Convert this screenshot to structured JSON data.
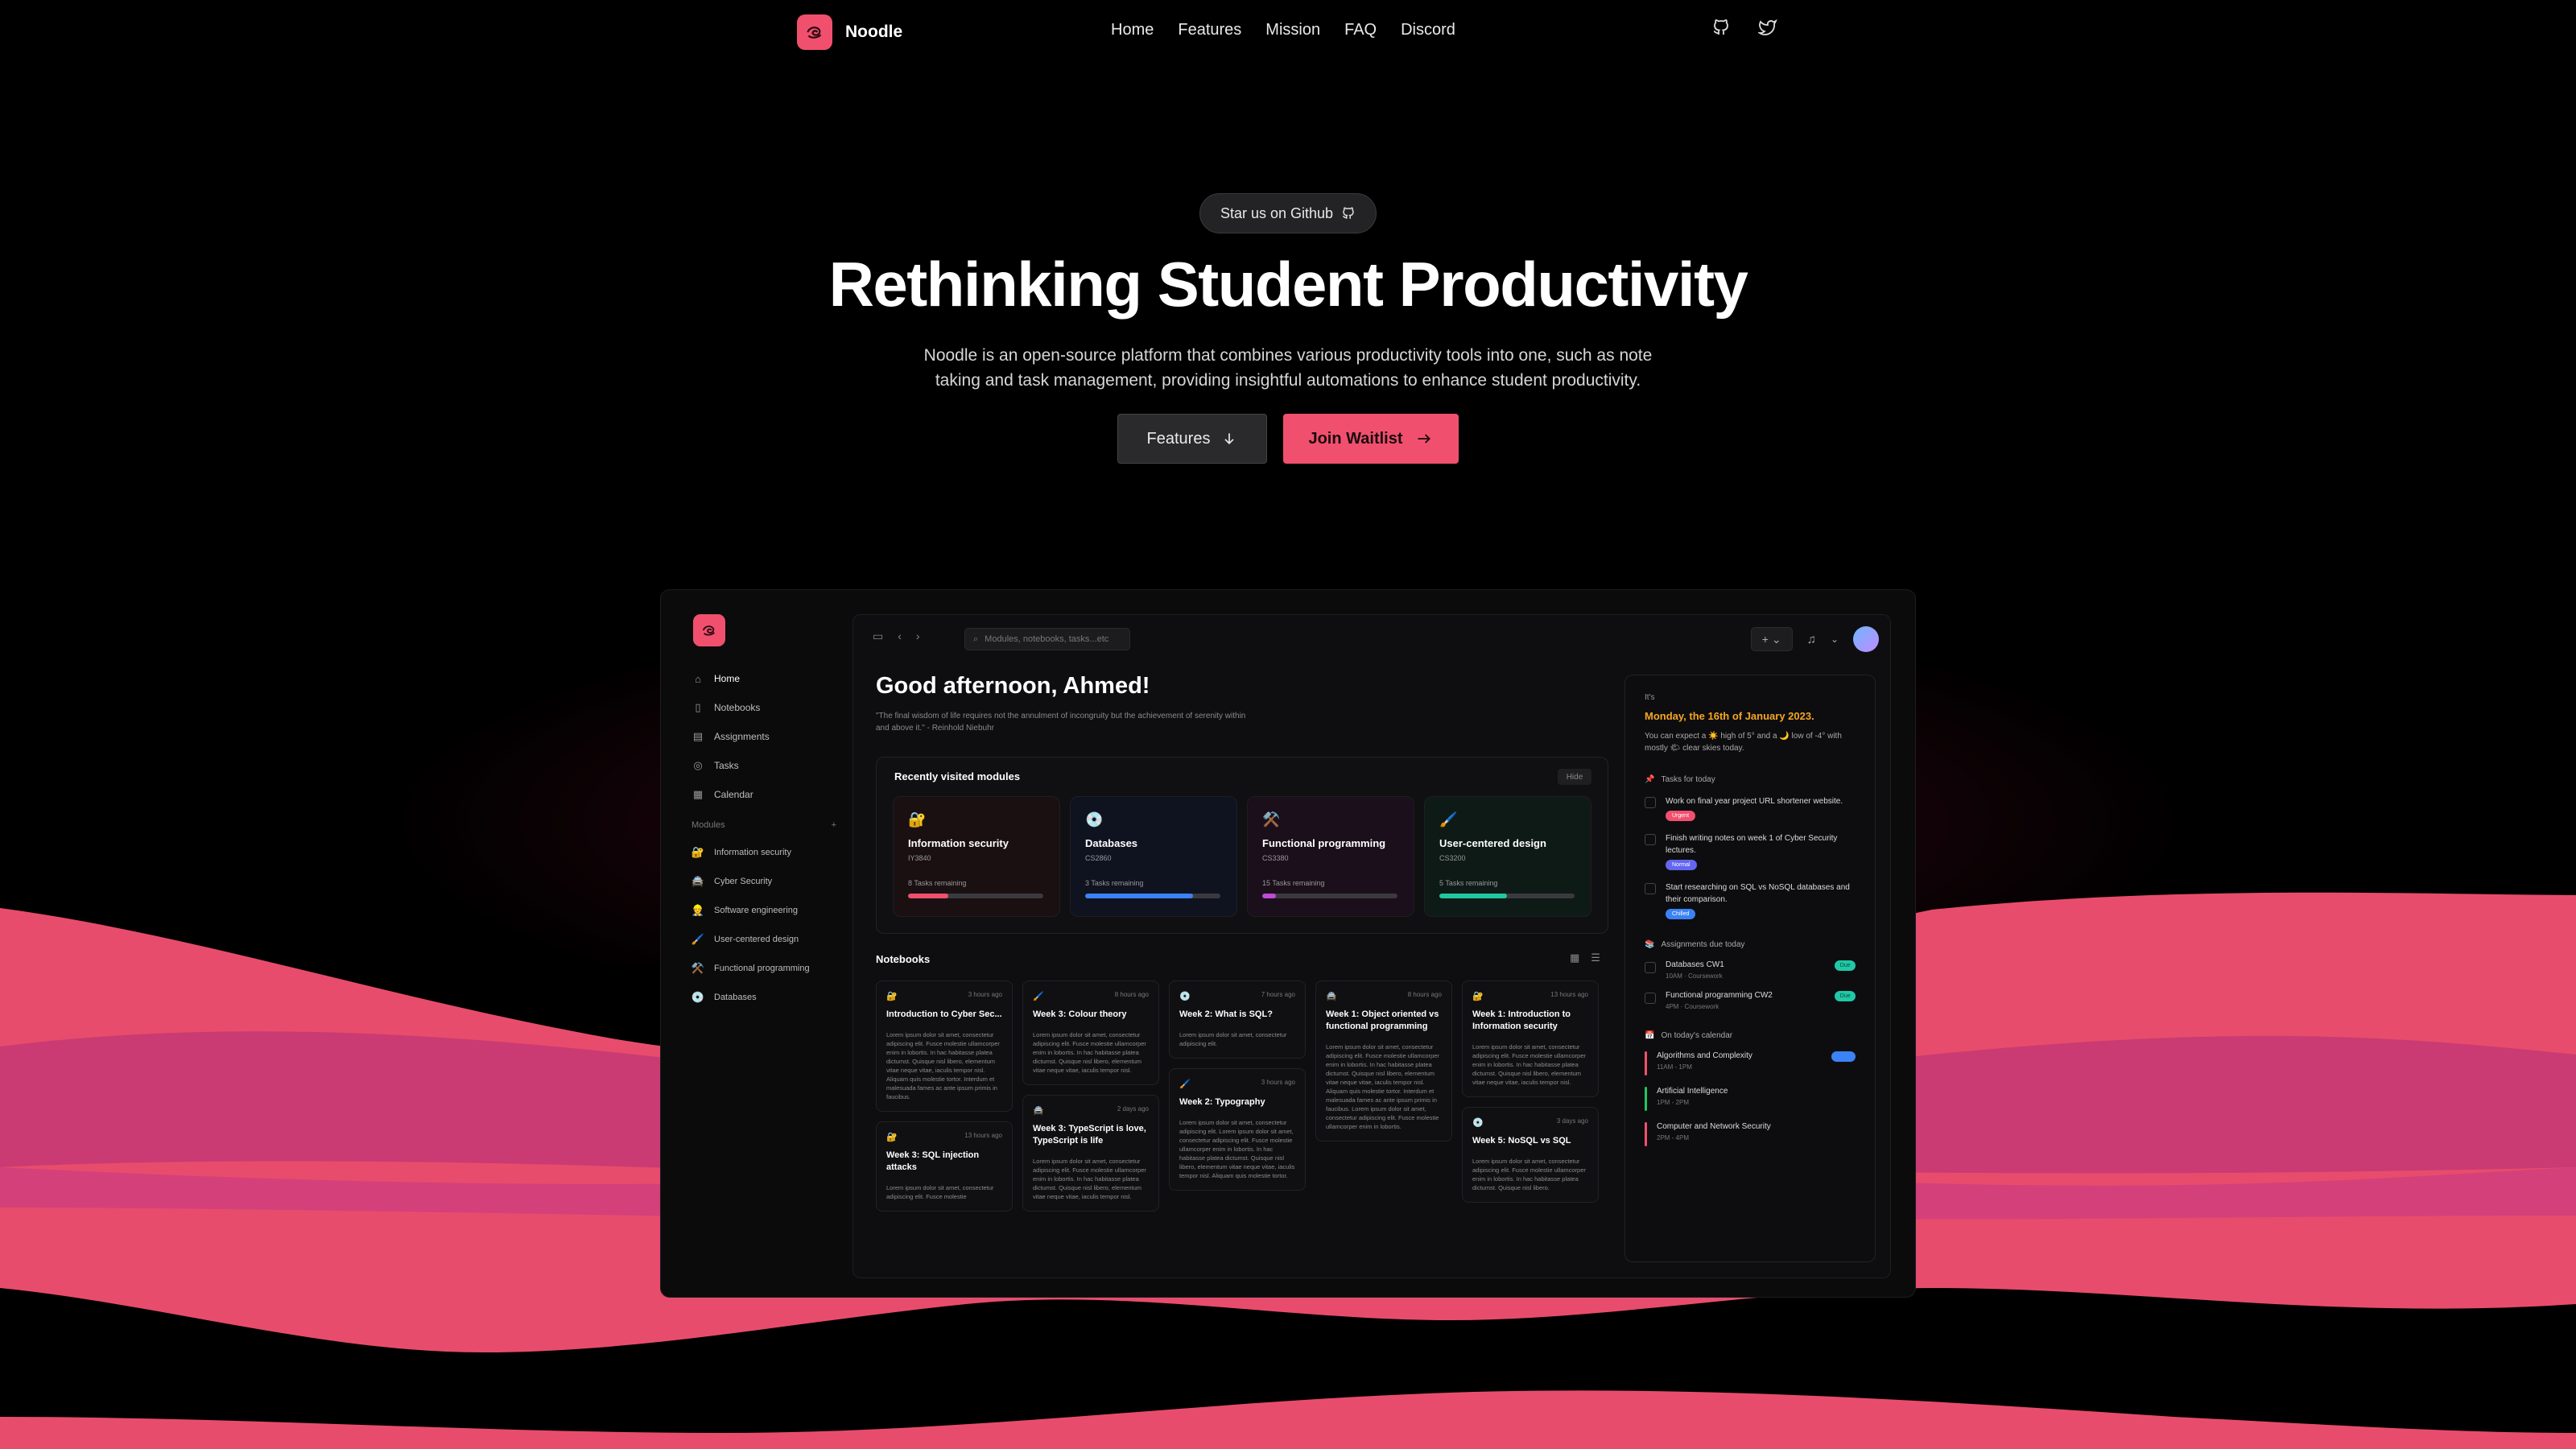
{
  "nav": {
    "brand": "Noodle",
    "links": [
      "Home",
      "Features",
      "Mission",
      "FAQ",
      "Discord"
    ],
    "icons": [
      "github-icon",
      "twitter-icon"
    ]
  },
  "hero": {
    "pill": "Star us on Github",
    "title": "Rethinking Student Productivity",
    "description": "Noodle is an open-source platform that combines various productivity tools into one, such as note taking and task management, providing insightful automations to enhance student productivity.",
    "features_button": "Features",
    "join_button": "Join Waitlist"
  },
  "colors": {
    "accent": "#f0506e",
    "wave_top": "#e84c6c",
    "wave_mid": "#c93b72",
    "background": "#000000"
  },
  "app": {
    "sidebar": {
      "nav": [
        {
          "label": "Home",
          "icon": "home-icon"
        },
        {
          "label": "Notebooks",
          "icon": "notebook-icon"
        },
        {
          "label": "Assignments",
          "icon": "assignment-icon"
        },
        {
          "label": "Tasks",
          "icon": "check-circle-icon"
        },
        {
          "label": "Calendar",
          "icon": "calendar-icon"
        }
      ],
      "modules_heading": "Modules",
      "modules": [
        {
          "label": "Information security",
          "emoji": "🔐"
        },
        {
          "label": "Cyber Security",
          "emoji": "🚔"
        },
        {
          "label": "Software engineering",
          "emoji": "👷"
        },
        {
          "label": "User-centered design",
          "emoji": "🖌️"
        },
        {
          "label": "Functional programming",
          "emoji": "⚒️"
        },
        {
          "label": "Databases",
          "emoji": "💿"
        }
      ]
    },
    "search_placeholder": "Modules, notebooks, tasks...etc",
    "greeting": "Good afternoon, Ahmed!",
    "quote": "\"The final wisdom of life requires not the annulment of incongruity but the achievement of serenity within and above it.\" - Reinhold Niebuhr",
    "recent": {
      "title": "Recently visited modules",
      "hide": "Hide",
      "modules": [
        {
          "emoji": "🔐",
          "name": "Information security",
          "code": "IY3840",
          "tasks": "8 Tasks remaining",
          "progress": 0.3,
          "color": "#f0506e",
          "bg": "#1a1012"
        },
        {
          "emoji": "💿",
          "name": "Databases",
          "code": "CS2860",
          "tasks": "3 Tasks remaining",
          "progress": 0.8,
          "color": "#3b82f6",
          "bg": "#0f1320"
        },
        {
          "emoji": "⚒️",
          "name": "Functional programming",
          "code": "CS3380",
          "tasks": "15 Tasks remaining",
          "progress": 0.1,
          "color": "#c04bd6",
          "bg": "#1a0f1b"
        },
        {
          "emoji": "🖌️",
          "name": "User-centered design",
          "code": "CS3200",
          "tasks": "5 Tasks remaining",
          "progress": 0.5,
          "color": "#22c7a0",
          "bg": "#0e1a16"
        }
      ]
    },
    "notebooks_title": "Notebooks",
    "notes": [
      [
        {
          "emoji": "🔐",
          "time": "3 hours ago",
          "title": "Introduction to Cyber Sec...",
          "body": "Lorem ipsum dolor sit amet, consectetur adipiscing elit. Fusce molestie ullamcorper enim in lobortis. In hac habitasse platea dictumst. Quisque nisl libero, elementum vitae neque vitae, iaculis tempor nisl. Aliquam quis molestie tortor. Interdum et malesuada fames ac ante ipsum primis in faucibus."
        },
        {
          "emoji": "🔐",
          "time": "13 hours ago",
          "title": "Week 3: SQL injection attacks",
          "body": "Lorem ipsum dolor sit amet, consectetur adipiscing elit. Fusce molestie"
        }
      ],
      [
        {
          "emoji": "🖌️",
          "time": "8 hours ago",
          "title": "Week 3: Colour theory",
          "body": "Lorem ipsum dolor sit amet, consectetur adipiscing elit. Fusce molestie ullamcorper enim in lobortis. In hac habitasse platea dictumst. Quisque nisl libero, elementum vitae neque vitae, iaculis tempor nisl."
        },
        {
          "emoji": "🚔",
          "time": "2 days ago",
          "title": "Week 3: TypeScript is love, TypeScript is life",
          "body": "Lorem ipsum dolor sit amet, consectetur adipiscing elit. Fusce molestie ullamcorper enim in lobortis. In hac habitasse platea dictumst. Quisque nisl libero, elementum vitae neque vitae, iaculis tempor nisl."
        }
      ],
      [
        {
          "emoji": "💿",
          "time": "7 hours ago",
          "title": "Week 2: What is SQL?",
          "body": "Lorem ipsum dolor sit amet, consectetur adipiscing elit."
        },
        {
          "emoji": "🖌️",
          "time": "3 hours ago",
          "title": "Week 2: Typography",
          "body": "Lorem ipsum dolor sit amet, consectetur adipiscing elit. Lorem ipsum dolor sit amet, consectetur adipiscing elit. Fusce molestie ullamcorper enim in lobortis. In hac habitasse platea dictumst. Quisque nisl libero, elementum vitae neque vitae, iaculis tempor nisl. Aliquam quis molestie tortor."
        }
      ],
      [
        {
          "emoji": "🚔",
          "time": "8 hours ago",
          "title": "Week 1: Object oriented vs functional programming",
          "body": "Lorem ipsum dolor sit amet, consectetur adipiscing elit. Fusce molestie ullamcorper enim in lobortis. In hac habitasse platea dictumst. Quisque nisl libero, elementum vitae neque vitae, iaculis tempor nisl. Aliquam quis molestie tortor. Interdum et malesuada fames ac ante ipsum primis in faucibus. Lorem ipsum dolor sit amet, consectetur adipiscing elit. Fusce molestie ullamcorper enim in lobortis."
        }
      ],
      [
        {
          "emoji": "🔐",
          "time": "13 hours ago",
          "title": "Week 1: Introduction to Information security",
          "body": "Lorem ipsum dolor sit amet, consectetur adipiscing elit. Fusce molestie ullamcorper enim in lobortis. In hac habitasse platea dictumst. Quisque nisl libero, elementum vitae neque vitae, iaculis tempor nisl."
        },
        {
          "emoji": "💿",
          "time": "3 days ago",
          "title": "Week 5: NoSQL vs SQL",
          "body": "Lorem ipsum dolor sit amet, consectetur adipiscing elit. Fusce molestie ullamcorper enim in lobortis. In hac habitasse platea dictumst. Quisque nisl libero."
        }
      ]
    ],
    "right_panel": {
      "its": "It's",
      "date": "Monday, the 16th of January 2023.",
      "weather": "You can expect a ☀️ high of 5° and a 🌙 low of -4° with mostly 🌤 clear skies today.",
      "tasks_heading": "Tasks for today",
      "tasks": [
        {
          "text": "Work on final year project URL shortener website.",
          "tag": "Urgent",
          "tag_color": "#f0506e"
        },
        {
          "text": "Finish writing notes on week 1 of Cyber Security lectures.",
          "tag": "Normal",
          "tag_color": "#6366f1"
        },
        {
          "text": "Start researching on SQL vs NoSQL databases and their comparison.",
          "tag": "Chilled",
          "tag_color": "#3b82f6"
        }
      ],
      "assignments_heading": "Assignments due today",
      "assignments": [
        {
          "title": "Databases CW1",
          "sub": "10AM · Coursework",
          "badge": "Due"
        },
        {
          "title": "Functional programming CW2",
          "sub": "4PM · Coursework",
          "badge": "Due"
        }
      ],
      "calendar_heading": "On today's calendar",
      "calendar": [
        {
          "title": "Algorithms and Complexity",
          "time": "11AM - 1PM",
          "color": "#f0506e"
        },
        {
          "title": "Artificial Intelligence",
          "time": "1PM - 2PM",
          "color": "#22c55e"
        },
        {
          "title": "Computer and Network Security",
          "time": "2PM - 4PM",
          "color": "#f0506e"
        }
      ]
    }
  }
}
